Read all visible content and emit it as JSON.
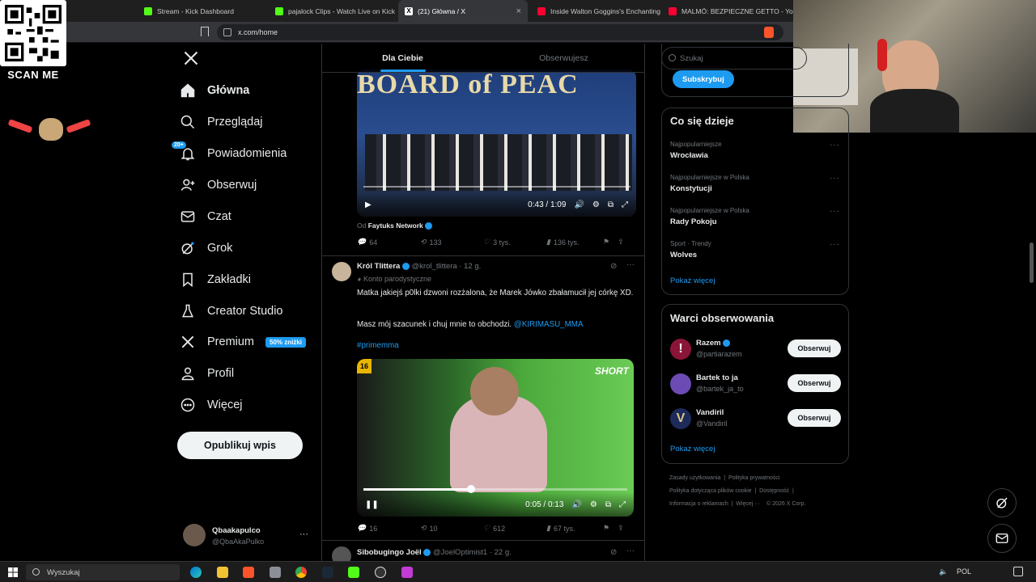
{
  "browser": {
    "tabs": [
      {
        "label": "Stream - Kick Dashboard",
        "color": "#53fc18"
      },
      {
        "label": "pajalock Clips - Watch Live on Kick",
        "color": "#53fc18"
      },
      {
        "label": "(21) Główna / X",
        "color": "#ffffff",
        "close": "×"
      },
      {
        "label": "Inside Walton Goggins's Enchanting",
        "color": "#ff0033"
      },
      {
        "label": "MALMÖ: BEZPIECZNE GETTO - YouTube",
        "color": "#ff0033"
      }
    ],
    "url": "x.com/home"
  },
  "overlay": {
    "scan_me": "SCAN ME"
  },
  "nav": {
    "items": [
      {
        "label": "Główna",
        "icon": "home-icon"
      },
      {
        "label": "Przeglądaj",
        "icon": "search-icon"
      },
      {
        "label": "Powiadomienia",
        "icon": "bell-icon",
        "badge": "20+"
      },
      {
        "label": "Obserwuj",
        "icon": "person-plus-icon"
      },
      {
        "label": "Czat",
        "icon": "mail-icon"
      },
      {
        "label": "Grok",
        "icon": "grok-icon"
      },
      {
        "label": "Zakładki",
        "icon": "bookmark-icon"
      },
      {
        "label": "Creator Studio",
        "icon": "flask-icon"
      },
      {
        "label": "Premium",
        "icon": "x-logo-icon",
        "badge": "50% zniżki"
      },
      {
        "label": "Profil",
        "icon": "person-icon"
      },
      {
        "label": "Więcej",
        "icon": "more-circle-icon"
      }
    ],
    "post_button": "Opublikuj wpis",
    "account": {
      "name": "Qbaakapulco",
      "handle": "@QbaAkaPulko",
      "more": "···"
    }
  },
  "feed": {
    "tabs": [
      "Dla Ciebie",
      "Obserwujesz"
    ],
    "post1": {
      "video_time": "0:43 / 1:09",
      "video_text": "BOARD of PEAC",
      "source_prefix": "Od",
      "source": "Faytuks Network",
      "replies": "64",
      "reposts": "133",
      "likes": "3 tys.",
      "views": "136 tys."
    },
    "post2": {
      "name": "Król Tlittera",
      "handle": "@krol_tlittera",
      "time": "· 12 g.",
      "label": "Konto parodystyczne",
      "text1": "Matka jakiejś p0lki dzwoni rozżalona, że Marek Jówko zbałamucił jej córkę XD.",
      "text2_prefix": "Masz mój szacunek i chuj mnie to obchodzi.",
      "mention": "@KIRIMASU_MMA",
      "hashtag": "#primemma",
      "video_time": "0:05 / 0:13",
      "video_badge": "SHORT",
      "video_age": "16",
      "replies": "16",
      "reposts": "10",
      "likes": "612",
      "views": "67 tys."
    },
    "post3": {
      "name": "Sibobugingo Joël",
      "handle": "@JoelOptimist1",
      "time": "· 22 g."
    }
  },
  "sidebar": {
    "search_placeholder": "Szukaj",
    "subscribe": "Subskrybuj",
    "trends_title": "Co się dzieje",
    "trends": [
      {
        "meta": "Najpopularniejsze",
        "name": "Wrocławia"
      },
      {
        "meta": "Najpopularniejsze w Polska",
        "name": "Konstytucji"
      },
      {
        "meta": "Najpopularniejsze w Polska",
        "name": "Rady Pokoju"
      },
      {
        "meta": "Sport · Trendy",
        "name": "Wolves"
      }
    ],
    "show_more": "Pokaż więcej",
    "who_title": "Warci obserwowania",
    "accounts": [
      {
        "name": "Razem",
        "handle": "@partiarazem",
        "color": "#8b1538"
      },
      {
        "name": "Bartek to ja",
        "handle": "@bartek_ja_to",
        "color": "#6c4bb4"
      },
      {
        "name": "Vandiril",
        "handle": "@Vandiril",
        "color": "#1e2a5a"
      }
    ],
    "follow": "Obserwuj",
    "footer": {
      "l1a": "Zasady użytkowania",
      "l1b": "Polityka prywatności",
      "l2a": "Polityka dotycząca plików cookie",
      "l2b": "Dostępność",
      "l3a": "Informacja o reklamach",
      "l3b": "Więcej ···",
      "l3c": "© 2026 X Corp."
    }
  },
  "taskbar": {
    "search": "Wyszukaj",
    "lang": "POL"
  },
  "colors": {
    "accent": "#1d9bf0",
    "bg": "#000000",
    "border": "#2f3336"
  }
}
